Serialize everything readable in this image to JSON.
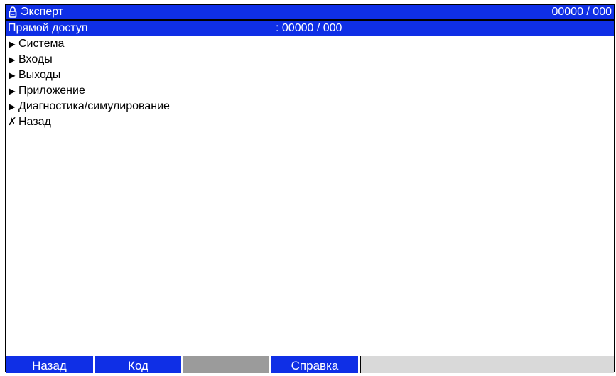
{
  "title_bar": {
    "icon": "lock-icon",
    "title": "Эксперт",
    "counter": "00000 / 000"
  },
  "direct_access": {
    "label": "Прямой доступ",
    "value": ": 00000 / 000"
  },
  "menu": [
    {
      "glyph": "▶",
      "icon": "right-triangle-icon",
      "label": "Система"
    },
    {
      "glyph": "▶",
      "icon": "right-triangle-icon",
      "label": "Входы"
    },
    {
      "glyph": "▶",
      "icon": "right-triangle-icon",
      "label": "Выходы"
    },
    {
      "glyph": "▶",
      "icon": "right-triangle-icon",
      "label": "Приложение"
    },
    {
      "glyph": "▶",
      "icon": "right-triangle-icon",
      "label": "Диагностика/симулирование"
    },
    {
      "glyph": "✗",
      "icon": "cross-icon",
      "label": "Назад"
    }
  ],
  "softkeys": [
    "Назад",
    "Код",
    "",
    "Справка"
  ],
  "colors": {
    "selection": "#0f2fe6",
    "blank_key": "#9b9b9b",
    "tail": "#d9d9d9"
  }
}
